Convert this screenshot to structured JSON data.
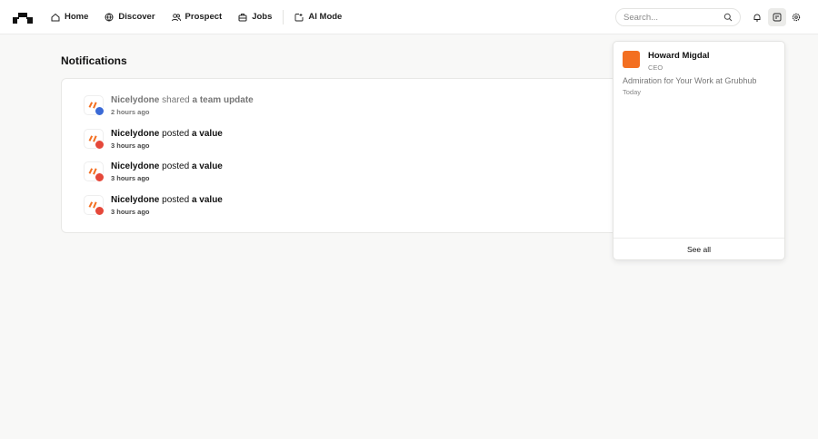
{
  "nav": {
    "items": [
      {
        "label": "Home",
        "icon": "home-icon"
      },
      {
        "label": "Discover",
        "icon": "globe-icon"
      },
      {
        "label": "Prospect",
        "icon": "users-icon"
      },
      {
        "label": "Jobs",
        "icon": "briefcase-icon"
      },
      {
        "label": "AI Mode",
        "icon": "ai-icon"
      }
    ]
  },
  "search": {
    "placeholder": "Search..."
  },
  "page_title": "Notifications",
  "notifications": [
    {
      "actor": "Nicelydone",
      "verb": "shared",
      "object": "a team update",
      "time": "2 hours ago",
      "read": true
    },
    {
      "actor": "Nicelydone",
      "verb": "posted",
      "object": "a value",
      "time": "3 hours ago"
    },
    {
      "actor": "Nicelydone",
      "verb": "posted",
      "object": "a value",
      "time": "3 hours ago"
    },
    {
      "actor": "Nicelydone",
      "verb": "posted",
      "object": "a value",
      "time": "3 hours ago"
    }
  ],
  "popup": {
    "name": "Howard Migdal",
    "role": "CEO",
    "message": "Admiration for Your Work at Grubhub",
    "time": "Today",
    "see_all": "See all"
  },
  "colors": {
    "accent": "#f36f21",
    "blue": "#3b6ad6",
    "red": "#e5483a"
  }
}
